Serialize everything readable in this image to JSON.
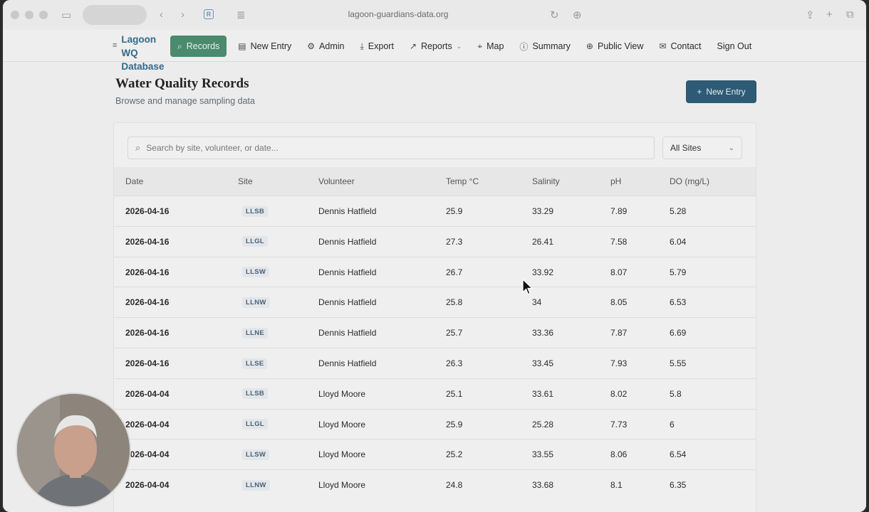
{
  "browser": {
    "url": "lagoon-guardians-data.org",
    "favicon_letter": "R"
  },
  "navbar": {
    "brand": [
      "Lagoon",
      "WQ",
      "Database"
    ],
    "items": [
      {
        "label": "Records",
        "icon": "search-icon",
        "active": true
      },
      {
        "label": "New Entry",
        "icon": "clipboard-icon"
      },
      {
        "label": "Admin",
        "icon": "gear-icon"
      },
      {
        "label": "Export",
        "icon": "download-icon"
      },
      {
        "label": "Reports",
        "icon": "trend-icon",
        "dropdown": true
      },
      {
        "label": "Map",
        "icon": "map-pin-icon"
      },
      {
        "label": "Summary",
        "icon": "info-icon"
      },
      {
        "label": "Public View",
        "icon": "globe-icon"
      },
      {
        "label": "Contact",
        "icon": "mail-icon"
      },
      {
        "label": "Sign Out",
        "icon": ""
      }
    ]
  },
  "header": {
    "title": "Water Quality Records",
    "subtitle": "Browse and manage sampling data",
    "new_entry_label": "New Entry"
  },
  "filters": {
    "search_placeholder": "Search by site, volunteer, or date...",
    "site_selected": "All Sites"
  },
  "table": {
    "columns": [
      "Date",
      "Site",
      "Volunteer",
      "Temp °C",
      "Salinity",
      "pH",
      "DO (mg/L)"
    ],
    "rows": [
      [
        "2026-04-16",
        "LLSB",
        "Dennis Hatfield",
        "25.9",
        "33.29",
        "7.89",
        "5.28"
      ],
      [
        "2026-04-16",
        "LLGL",
        "Dennis Hatfield",
        "27.3",
        "26.41",
        "7.58",
        "6.04"
      ],
      [
        "2026-04-16",
        "LLSW",
        "Dennis Hatfield",
        "26.7",
        "33.92",
        "8.07",
        "5.79"
      ],
      [
        "2026-04-16",
        "LLNW",
        "Dennis Hatfield",
        "25.8",
        "34",
        "8.05",
        "6.53"
      ],
      [
        "2026-04-16",
        "LLNE",
        "Dennis Hatfield",
        "25.7",
        "33.36",
        "7.87",
        "6.69"
      ],
      [
        "2026-04-16",
        "LLSE",
        "Dennis Hatfield",
        "26.3",
        "33.45",
        "7.93",
        "5.55"
      ],
      [
        "2026-04-04",
        "LLSB",
        "Lloyd Moore",
        "25.1",
        "33.61",
        "8.02",
        "5.8"
      ],
      [
        "2026-04-04",
        "LLGL",
        "Lloyd Moore",
        "25.9",
        "25.28",
        "7.73",
        "6"
      ],
      [
        "2026-04-04",
        "LLSW",
        "Lloyd Moore",
        "25.2",
        "33.55",
        "8.06",
        "6.54"
      ],
      [
        "2026-04-04",
        "LLNW",
        "Lloyd Moore",
        "24.8",
        "33.68",
        "8.1",
        "6.35"
      ]
    ]
  },
  "colors": {
    "accent_green": "#4a8a6d",
    "primary_button": "#2d5a74",
    "brand": "#2f6a8c"
  }
}
